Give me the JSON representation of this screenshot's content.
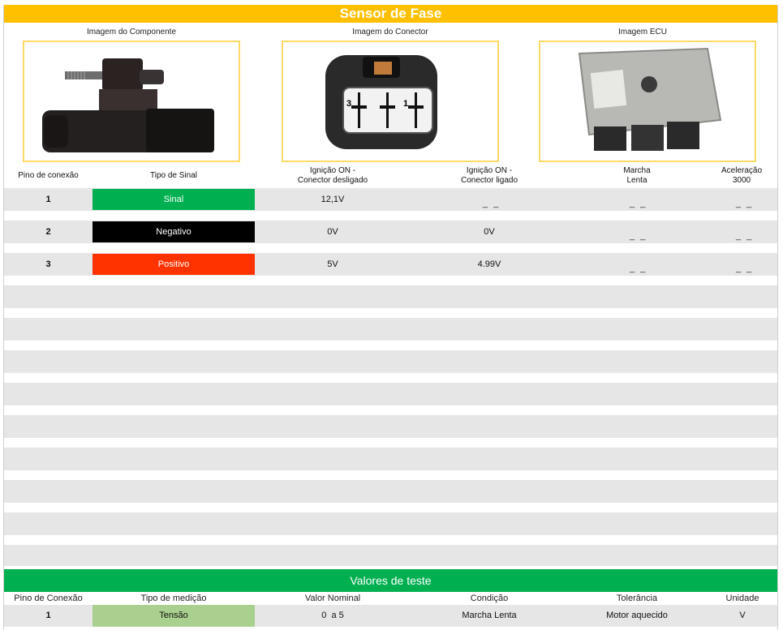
{
  "title": "Sensor de Fase",
  "images": {
    "component_label": "Imagem do Componente",
    "connector_label": "Imagem do Conector",
    "ecu_label": "Imagem ECU",
    "connector_pin_left": "3",
    "connector_pin_right": "1"
  },
  "pin_table": {
    "headers": {
      "pin": "Pino de conexão",
      "signal_type": "Tipo de Sinal",
      "ign_off_1": "Ignição ON -",
      "ign_off_2": "Conector desligado",
      "ign_on_1": "Ignição ON -",
      "ign_on_2": "Conector ligado",
      "idle_1": "Marcha",
      "idle_2": "Lenta",
      "accel_1": "Aceleração",
      "accel_2": "3000"
    },
    "rows": [
      {
        "pin": "1",
        "signal": "Sinal",
        "signal_color": "#00b050",
        "disconnected": "12,1V",
        "connected": "_ _",
        "idle": "_ _",
        "accel": "_ _"
      },
      {
        "pin": "2",
        "signal": "Negativo",
        "signal_color": "#000000",
        "disconnected": "0V",
        "connected": "0V",
        "idle": "_ _",
        "accel": "_ _"
      },
      {
        "pin": "3",
        "signal": "Positivo",
        "signal_color": "#ff3300",
        "disconnected": "5V",
        "connected": "4.99V",
        "idle": "_ _",
        "accel": "_ _"
      }
    ]
  },
  "test_values": {
    "title": "Valores de teste",
    "headers": {
      "pin": "Pino de Conexão",
      "measure": "Tipo de medição",
      "nominal": "Valor Nominal",
      "condition": "Condição",
      "tolerance": "Tolerância",
      "unit": "Unidade"
    },
    "rows": [
      {
        "pin": "1",
        "measure": "Tensão",
        "nominal": "0  a 5",
        "condition": "Marcha Lenta",
        "tolerance": "Motor aquecido",
        "unit": "V"
      }
    ]
  },
  "colors": {
    "title_bar": "#ffc000",
    "test_bar": "#00b050",
    "measure_cell": "#a9d08e",
    "band": "#e6e6e6"
  }
}
